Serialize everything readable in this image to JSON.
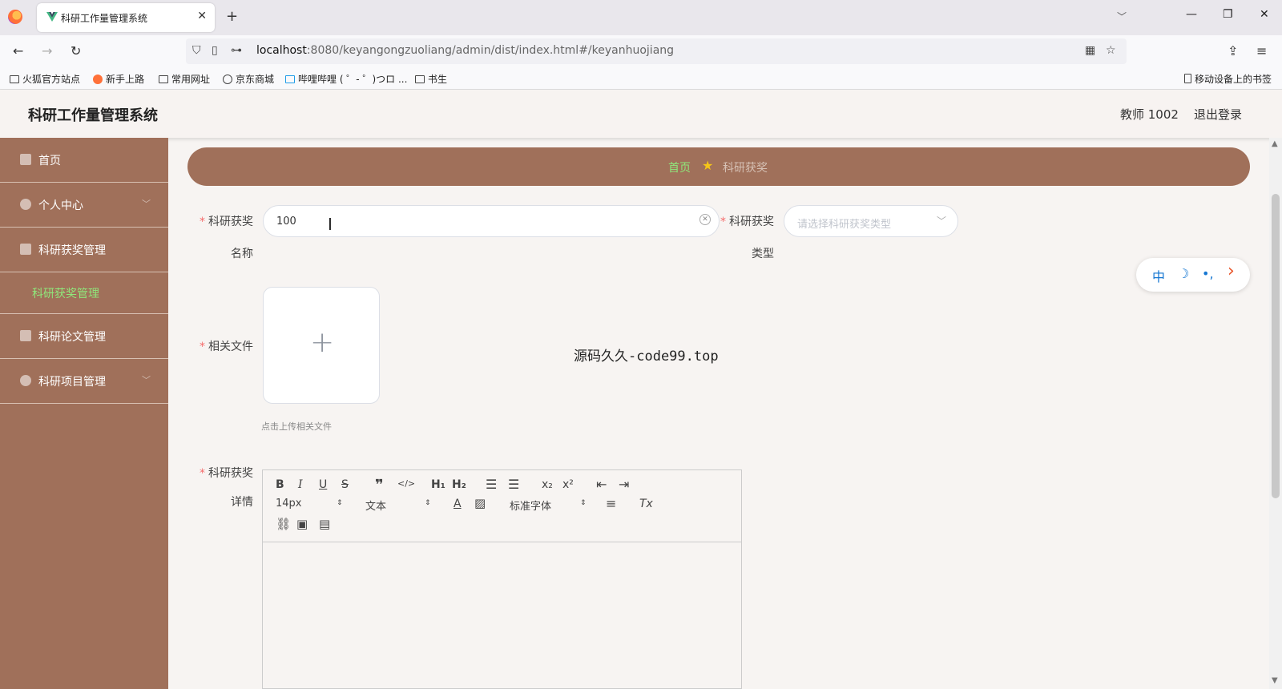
{
  "browser": {
    "tab_title": "科研工作量管理系统",
    "tab_close": "✕",
    "new_tab": "+",
    "url_host": "localhost",
    "url_rest": ":8080/keyangongzuoliang/admin/dist/index.html#/keyanhuojiang",
    "bookmarks": [
      "火狐官方站点",
      "新手上路",
      "常用网址",
      "京东商城",
      "哔哩哔哩 ( ゜- ゜)つロ ...",
      "书生"
    ],
    "mobile_bookmarks": "移动设备上的书签"
  },
  "header": {
    "title": "科研工作量管理系统",
    "user": "教师 1002",
    "logout": "退出登录"
  },
  "sidebar": {
    "items": [
      {
        "label": "首页",
        "icon": "home-icon"
      },
      {
        "label": "个人中心",
        "icon": "user-icon"
      },
      {
        "label": "科研获奖管理",
        "icon": "award-icon"
      },
      {
        "label": "科研论文管理",
        "icon": "paper-icon"
      },
      {
        "label": "科研项目管理",
        "icon": "project-icon"
      }
    ],
    "sub_item": "科研获奖管理"
  },
  "breadcrumb": {
    "home": "首页",
    "current": "科研获奖"
  },
  "form": {
    "name_label_1": "科研获奖",
    "name_label_2": "名称",
    "name_value": "100",
    "type_label_1": "科研获奖",
    "type_label_2": "类型",
    "type_placeholder": "请选择科研获奖类型",
    "file_label": "相关文件",
    "upload_tip": "点击上传相关文件",
    "detail_label_1": "科研获奖",
    "detail_label_2": "详情"
  },
  "editor": {
    "font_size": "14px",
    "header_select": "文本",
    "font_family": "标准字体"
  },
  "float_tools": [
    "中",
    "☽",
    "•,",
    "›"
  ],
  "center_text": "源码久久-code99.top",
  "colors": {
    "sidebar": "#a0705a",
    "accent_green": "#8fe87b",
    "required": "#f56c6c"
  }
}
